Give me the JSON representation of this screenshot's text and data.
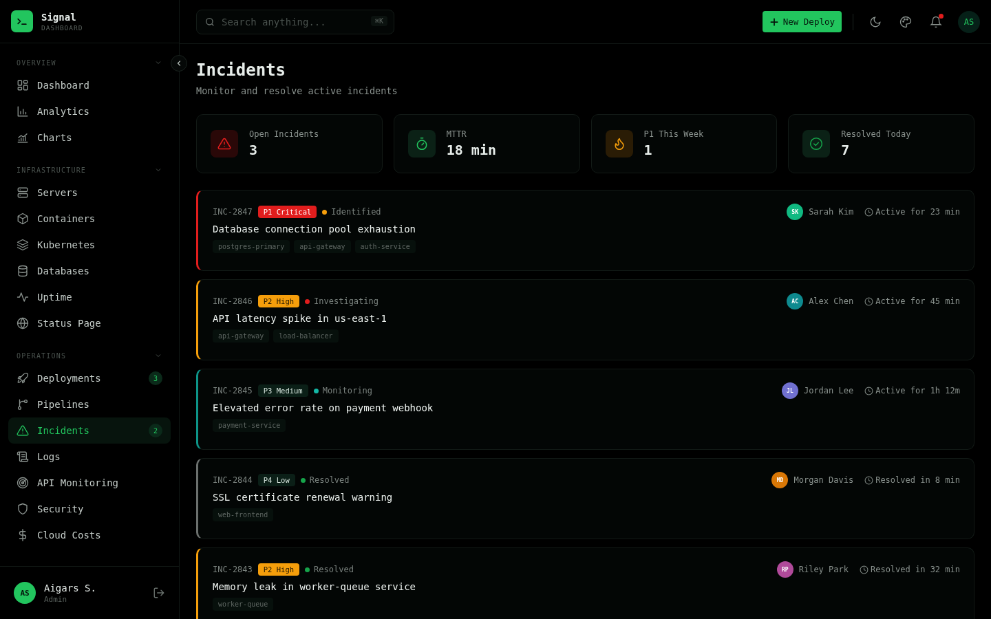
{
  "brand": {
    "name": "Signal",
    "subtitle": "DASHBOARD"
  },
  "sidebar": {
    "sections": [
      {
        "title": "OVERVIEW",
        "expanded": true,
        "items": [
          {
            "label": "Dashboard",
            "selected": false
          },
          {
            "label": "Analytics",
            "selected": false
          },
          {
            "label": "Charts",
            "selected": false
          }
        ]
      },
      {
        "title": "INFRASTRUCTURE",
        "expanded": true,
        "items": [
          {
            "label": "Servers",
            "selected": false
          },
          {
            "label": "Containers",
            "selected": false
          },
          {
            "label": "Kubernetes",
            "selected": false
          },
          {
            "label": "Databases",
            "selected": false
          },
          {
            "label": "Uptime",
            "selected": false
          },
          {
            "label": "Status Page",
            "selected": false
          }
        ]
      },
      {
        "title": "OPERATIONS",
        "expanded": true,
        "items": [
          {
            "label": "Deployments",
            "selected": false,
            "badge": "3"
          },
          {
            "label": "Pipelines",
            "selected": false
          },
          {
            "label": "Incidents",
            "selected": true,
            "badge": "2"
          },
          {
            "label": "Logs",
            "selected": false
          },
          {
            "label": "API Monitoring",
            "selected": false
          },
          {
            "label": "Security",
            "selected": false
          },
          {
            "label": "Cloud Costs",
            "selected": false
          }
        ]
      }
    ],
    "user": {
      "initials": "AS",
      "name": "Aigars S.",
      "role": "Admin"
    }
  },
  "header": {
    "search": {
      "placeholder": "Search anything...",
      "shortcut": "⌘K"
    },
    "new_button": "New Deploy",
    "notification_unread": true,
    "avatar": "AS"
  },
  "page": {
    "title": "Incidents",
    "subtitle": "Monitor and resolve active incidents"
  },
  "stats": [
    {
      "kind": "danger",
      "label": "Open Incidents",
      "value": "3"
    },
    {
      "kind": "timer",
      "label": "MTTR",
      "value": "18 min"
    },
    {
      "kind": "flame",
      "label": "P1 This Week",
      "value": "1"
    },
    {
      "kind": "resolved",
      "label": "Resolved Today",
      "value": "7"
    }
  ],
  "incidents": [
    {
      "id": "INC-2847",
      "kind": "critical",
      "priority": "P1 Critical",
      "status": {
        "label": "Identified",
        "color": "#f59e0b"
      },
      "title": "Database connection pool exhaustion",
      "tags": [
        "postgres-primary",
        "api-gateway",
        "auth-service"
      ],
      "assignee": {
        "initials": "SK",
        "name": "Sarah Kim",
        "color": "#10b981"
      },
      "duration": "Active for 23 min"
    },
    {
      "id": "INC-2846",
      "kind": "high",
      "priority": "P2 High",
      "status": {
        "label": "Investigating",
        "color": "#e11d1d"
      },
      "title": "API latency spike in us-east-1",
      "tags": [
        "api-gateway",
        "load-balancer"
      ],
      "assignee": {
        "initials": "AC",
        "name": "Alex Chen",
        "color": "#0e8a8f"
      },
      "duration": "Active for 45 min"
    },
    {
      "id": "INC-2845",
      "kind": "medium",
      "priority": "P3 Medium",
      "status": {
        "label": "Monitoring",
        "color": "#14b8a6"
      },
      "title": "Elevated error rate on payment webhook",
      "tags": [
        "payment-service"
      ],
      "assignee": {
        "initials": "JL",
        "name": "Jordan Lee",
        "color": "#7070d0"
      },
      "duration": "Active for 1h 12m"
    },
    {
      "id": "INC-2844",
      "kind": "low",
      "priority": "P4 Low",
      "status": {
        "label": "Resolved",
        "color": "#16a34a"
      },
      "title": "SSL certificate renewal warning",
      "tags": [
        "web-frontend"
      ],
      "assignee": {
        "initials": "MD",
        "name": "Morgan Davis",
        "color": "#d97706"
      },
      "duration": "Resolved in 8 min"
    },
    {
      "id": "INC-2843",
      "kind": "high",
      "priority": "P2 High",
      "status": {
        "label": "Resolved",
        "color": "#16a34a"
      },
      "title": "Memory leak in worker-queue service",
      "tags": [
        "worker-queue"
      ],
      "assignee": {
        "initials": "RP",
        "name": "Riley Park",
        "color": "#b04a9a"
      },
      "duration": "Resolved in 32 min"
    }
  ]
}
